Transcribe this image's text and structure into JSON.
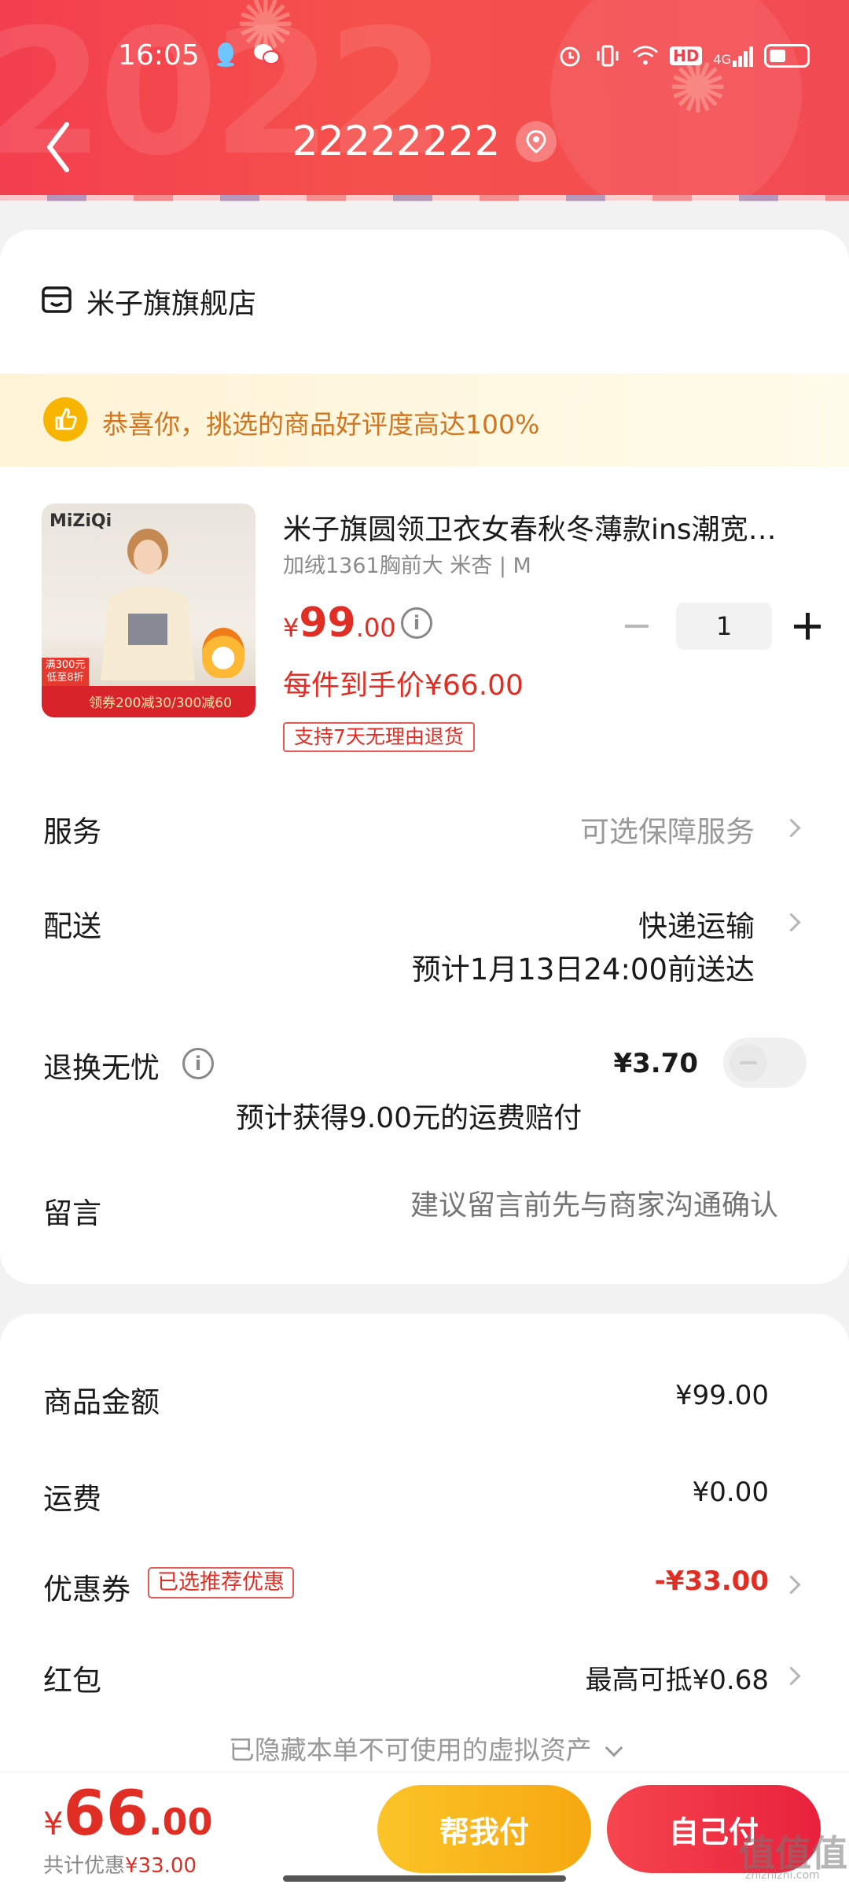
{
  "status_bar": {
    "time": "16:05",
    "network": "4G",
    "hd": "HD"
  },
  "nav": {
    "title": "22222222"
  },
  "shop": {
    "name": "米子旗旗舰店"
  },
  "praise": {
    "text": "恭喜你，挑选的商品好评度高达100%"
  },
  "product": {
    "image": {
      "brand": "MiZiQi",
      "banner_tag": "满300元\n低至8折",
      "banner_text": "领券200减30/300减60"
    },
    "title": "米子旗圆领卫衣女春秋冬薄款ins潮宽…",
    "spec": "加绒1361胸前大 米杏 | M",
    "price_symbol": "¥",
    "price_int": "99",
    "price_dec": ".00",
    "quantity": "1",
    "each_price": "每件到手价¥66.00",
    "return_tag": "支持7天无理由退货"
  },
  "service": {
    "label": "服务",
    "value": "可选保障服务"
  },
  "delivery": {
    "label": "配送",
    "value": "快递运输",
    "eta": "预计1月13日24:00前送达"
  },
  "return_worry": {
    "label": "退换无忧",
    "price": "¥3.70",
    "compensation": "预计获得9.00元的运费赔付",
    "enabled": false
  },
  "message": {
    "label": "留言",
    "placeholder": "建议留言前先与商家沟通确认"
  },
  "summary": {
    "goods_label": "商品金额",
    "goods_value": "¥99.00",
    "shipping_label": "运费",
    "shipping_value": "¥0.00",
    "coupon_label": "优惠券",
    "coupon_tag": "已选推荐优惠",
    "coupon_value": "-¥33.00",
    "redpacket_label": "红包",
    "redpacket_value": "最高可抵¥0.68",
    "hidden_assets": "已隐藏本单不可使用的虚拟资产"
  },
  "bottom": {
    "total_symbol": "¥",
    "total_int": "66",
    "total_dec": ".00",
    "saved_label": "共计优惠",
    "saved_amount": "¥33.00",
    "help_pay": "帮我付",
    "self_pay": "自己付"
  },
  "watermark": {
    "text": "值值值",
    "sub": "zhizhizhi.com"
  },
  "colors": {
    "accent_red": "#e02e24",
    "header_red": "#f33f4e",
    "help_yellow": "#fbc428",
    "praise_orange": "#d2751f"
  }
}
